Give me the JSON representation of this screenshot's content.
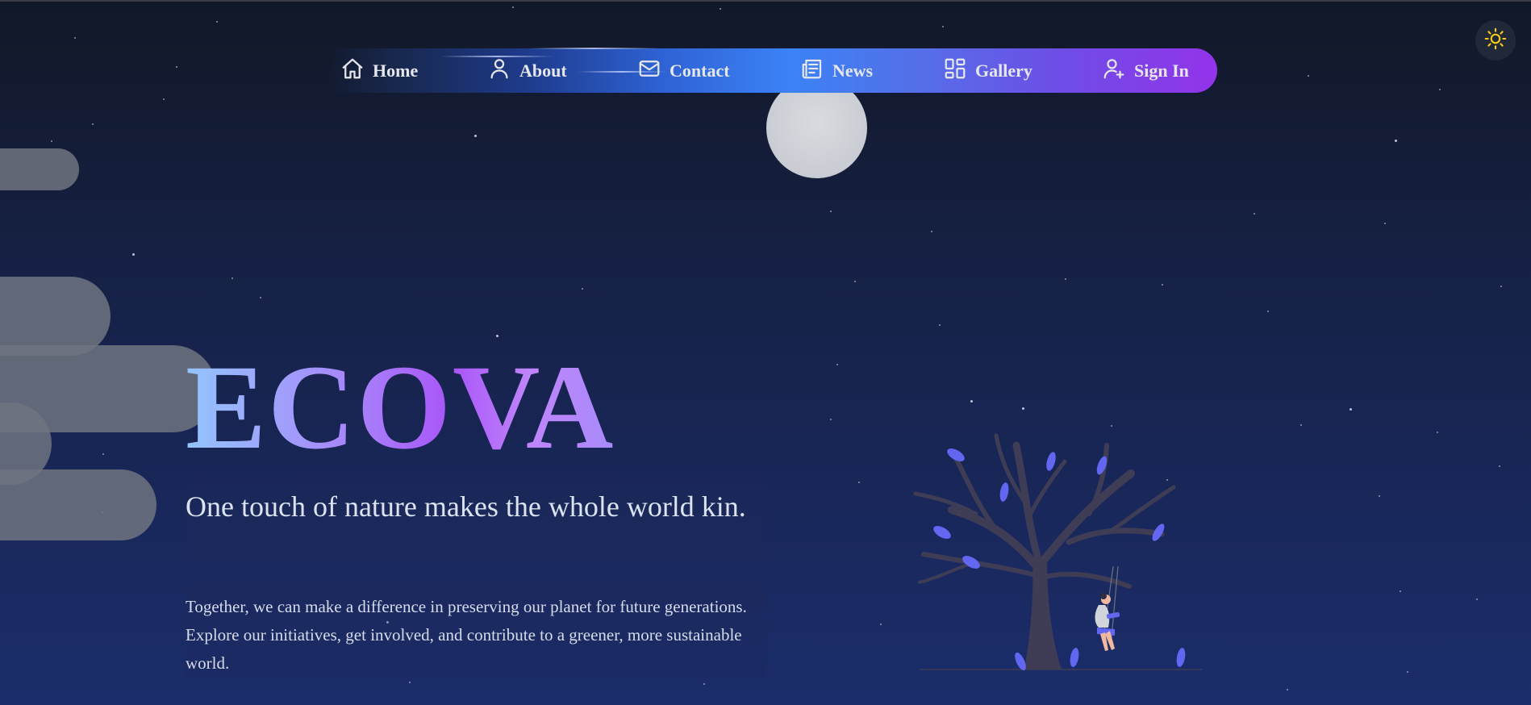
{
  "theme_toggle": {
    "icon": "sun-icon",
    "color": "#facc15"
  },
  "nav": {
    "items": [
      {
        "label": "Home",
        "icon": "home-icon"
      },
      {
        "label": "About",
        "icon": "user-icon"
      },
      {
        "label": "Contact",
        "icon": "mail-icon"
      },
      {
        "label": "News",
        "icon": "newspaper-icon"
      },
      {
        "label": "Gallery",
        "icon": "grid-icon"
      },
      {
        "label": "Sign In",
        "icon": "user-plus-icon"
      }
    ],
    "gradient": [
      "#1e3a8a",
      "#3b82f6",
      "#9333ea"
    ]
  },
  "hero": {
    "title": "ECOVA",
    "tagline": "One touch of nature makes the whole world kin.",
    "description": "Together, we can make a difference in preserving our planet for future generations. Explore our initiatives, get involved, and contribute to a greener, more sustainable world."
  },
  "colors": {
    "background_top": "#111827",
    "background_bottom": "#1b2d6b",
    "leaf": "#6366f1",
    "tree": "#3f3d56"
  }
}
